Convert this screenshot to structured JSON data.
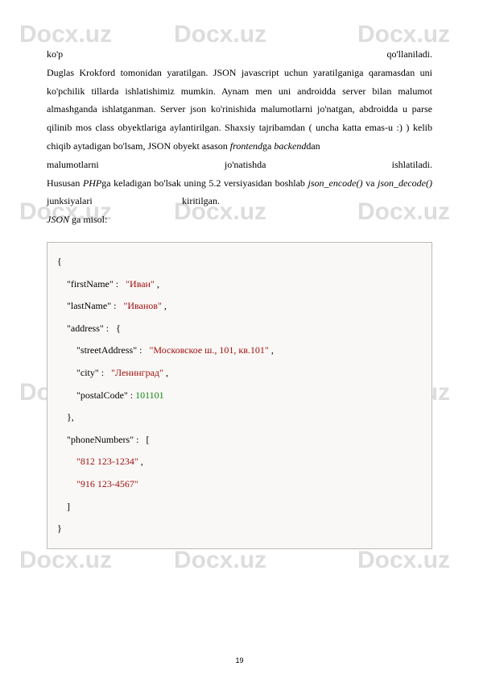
{
  "watermark": "Docx.uz",
  "paragraph": {
    "line1_left": "ko'p",
    "line1_right": "qo'llaniladi.",
    "body1": "Duglas Krokford tomonidan yaratilgan. JSON javascript uchun yaratilganiga qaramasdan uni ko'pchilik tillarda ishlatishimiz mumkin. Aynam men uni androidda server bilan malumot almashganda ishlatganman. Server json ko'rinishida malumotlarni jo'natgan, abdroidda u parse qilinib mos class obyektlariga aylantirilgan. Shaxsiy tajribamdan ( uncha katta emas-u :) ) kelib chiqib aytadigan bo'lsam, JSON obyekt asason ",
    "frontend": "frontend",
    "body2": "ga ",
    "backend": "backend",
    "body3": "dan",
    "line8_left": "malumotlarni",
    "line8_mid": "jo'natishda",
    "line8_right": "ishlatiladi.",
    "body4a": "Hususan ",
    "php": "PHP",
    "body4b": "ga keladigan bo'lsak uning 5.2 versiyasidan boshlab ",
    "json_encode": "json_encode()",
    "body5": " va ",
    "json_decode": "json_decode()",
    "body6": " junksiyalari",
    "body6_right": "kiritilgan.",
    "body7": "JSON",
    "body8": " ga misol:"
  },
  "code": {
    "l1": "{",
    "l2a": "    \"firstName\" :   ",
    "l2b": "\"Иван\" ",
    "l2c": ",",
    "l3a": "    \"lastName\" :   ",
    "l3b": "\"Иванов\" ",
    "l3c": ",",
    "l4a": "    \"address\" :   {",
    "l5a": "        \"streetAddress\" :   ",
    "l5b": "\"Московское ш., 101, кв.101\" ",
    "l5c": ",",
    "l6a": "        \"city\" :   ",
    "l6b": "\"Ленинград\" ",
    "l6c": ",",
    "l7a": "        \"postalCode\" : ",
    "l7b": "101101",
    "l8": "    },",
    "l9": "    \"phoneNumbers\" :   [",
    "l10a": "        ",
    "l10b": "\"812 123-1234\" ",
    "l10c": ",",
    "l11a": "        ",
    "l11b": "\"916 123-4567\"",
    "l12": "    ]",
    "l13": "}"
  },
  "page_number": "19"
}
